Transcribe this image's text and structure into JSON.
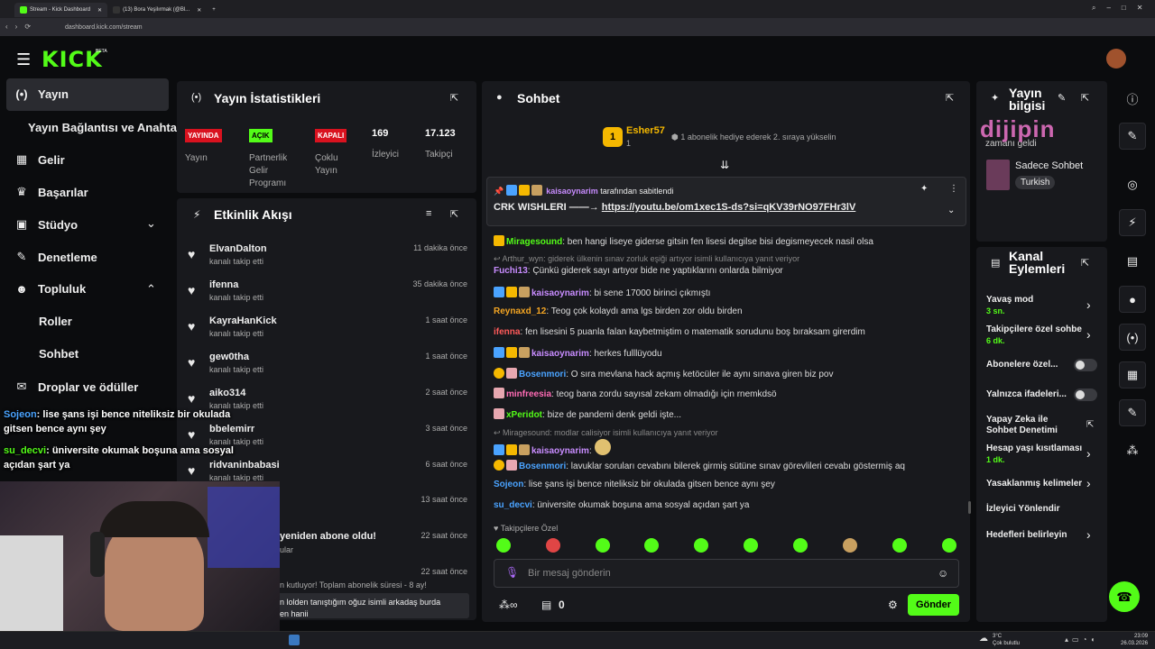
{
  "browser": {
    "tabs": [
      {
        "label": "Stream - Kick Dashboard",
        "active": true
      },
      {
        "label": "(13) Bora Yeşilırmak (@Bl...",
        "active": false
      }
    ],
    "url": "dashboard.kick.com/stream"
  },
  "brand": {
    "logo": "KICK",
    "beta": "BETA",
    "accent": "#53fc18"
  },
  "sidebar": {
    "items": [
      {
        "label": "Yayın",
        "icon": "broadcast-icon",
        "active": true
      },
      {
        "label": "Yayın Bağlantısı ve Anahtarı",
        "icon": ""
      },
      {
        "label": "Gelir",
        "icon": "chart-icon"
      },
      {
        "label": "Başarılar",
        "icon": "trophy-icon"
      },
      {
        "label": "Stüdyo",
        "icon": "studio-icon"
      },
      {
        "label": "Denetleme",
        "icon": "wrench-icon"
      },
      {
        "label": "Topluluk",
        "icon": "community-icon"
      },
      {
        "label": "Roller",
        "icon": ""
      },
      {
        "label": "Sohbet",
        "icon": ""
      },
      {
        "label": "Droplar ve ödüller",
        "icon": "gift-icon"
      }
    ]
  },
  "stats": {
    "title": "Yayın İstatistikleri",
    "badges": [
      "YAYINDA",
      "AÇIK",
      "KAPALI"
    ],
    "labels": [
      "Yayın",
      "Partnerlik Gelir Programı",
      "Çoklu Yayın"
    ],
    "viewers": "169",
    "viewers_label": "İzleyici",
    "followers": "17.123",
    "followers_label": "Takipçi"
  },
  "activity": {
    "title": "Etkinlik Akışı",
    "items": [
      {
        "name": "ElvanDalton",
        "action": "kanalı takip etti",
        "time": "11 dakika önce"
      },
      {
        "name": "ifenna",
        "action": "kanalı takip etti",
        "time": "35 dakika önce"
      },
      {
        "name": "KayraHanKick",
        "action": "kanalı takip etti",
        "time": "1 saat önce"
      },
      {
        "name": "gew0tha",
        "action": "kanalı takip etti",
        "time": "1 saat önce"
      },
      {
        "name": "aiko314",
        "action": "kanalı takip etti",
        "time": "2 saat önce"
      },
      {
        "name": "bbelemirr",
        "action": "kanalı takip etti",
        "time": "3 saat önce"
      },
      {
        "name": "ridvaninbabasi",
        "action": "kanalı takip etti",
        "time": "6 saat önce"
      }
    ],
    "extra": [
      {
        "text": "",
        "time": "13 saat önce"
      },
      {
        "text": "yeniden abone oldu!",
        "sub": "ular",
        "time": "22 saat önce"
      },
      {
        "text": "",
        "time": "22 saat önce"
      }
    ],
    "sub_line": "n kutluyor! Toplam abonelik süresi - 8 ay!",
    "sub_msg": "n lolden tanıştığım oğuz isimli arkadaş burda",
    "sub_msg2": "en hanii"
  },
  "chat": {
    "title": "Sohbet",
    "gifter": {
      "rank": "1",
      "name": "Esher57",
      "count": "1",
      "note": "1 abonelik hediye ederek 2. sıraya yükselin"
    },
    "pinned": {
      "user": "kaisaoynarim",
      "by": "tarafından sabitlendi",
      "text": "CRK WISHLERI ——→",
      "link": "https://youtu.be/om1xec1S-ds?si=qKV39rNO97FHr3lV"
    },
    "messages": [
      {
        "type": "msg",
        "user": "Miragesound",
        "color": "#53fc18",
        "text": "ben hangi liseye giderse gitsin fen lisesi degilse bisi degismeyecek nasil olsa"
      },
      {
        "type": "reply",
        "text": "Arthur_wyn: giderek ülkenin sınav zorluk eşiği artıyor isimli kullanıcıya yanıt veriyor"
      },
      {
        "type": "msg",
        "user": "Fuchi13",
        "color": "#c88cff",
        "text": "Çünkü giderek sayı artıyor bide ne yaptıklarını onlarda bilmiyor"
      },
      {
        "type": "msg",
        "user": "kaisaoynarim",
        "color": "#c88cff",
        "text": "bi sene 17000 birinci çıkmıştı"
      },
      {
        "type": "msg",
        "user": "Reynaxd_12",
        "color": "#f5a623",
        "text": "Teog çok kolaydı ama lgs birden zor oldu birden"
      },
      {
        "type": "msg",
        "user": "ifenna",
        "color": "#ff5a5a",
        "text": "fen lisesini 5 puanla falan kaybetmiştim o matematik sorudunu boş bıraksam girerdim"
      },
      {
        "type": "msg",
        "user": "kaisaoynarim",
        "color": "#c88cff",
        "text": "herkes fulllüyodu"
      },
      {
        "type": "msg",
        "user": "Bosenmori",
        "color": "#4aa3ff",
        "text": "O sıra mevlana hack açmış ketöcüler ile aynı sınava giren biz pov"
      },
      {
        "type": "msg",
        "user": "minfreesia",
        "color": "#ff6bb5",
        "text": "teog bana zordu sayısal zekam olmadığı için rnemkdsö"
      },
      {
        "type": "msg",
        "user": "xPeridot",
        "color": "#53fc18",
        "text": "bize de pandemi denk geldi işte..."
      },
      {
        "type": "reply",
        "text": "Miragesound: modlar calisiyor isimli kullanıcıya yanıt veriyor"
      },
      {
        "type": "msg",
        "user": "kaisaoynarim",
        "color": "#c88cff",
        "text": ""
      },
      {
        "type": "msg",
        "user": "Bosenmori",
        "color": "#4aa3ff",
        "text": "lavuklar soruları cevabını bilerek girmiş sütüne sınav görevlileri cevabı göstermiş aq"
      },
      {
        "type": "msg",
        "user": "Sojeon",
        "color": "#4aa3ff",
        "text": "lise şans işi bence niteliksiz bir okulada gitsen bence aynı şey"
      },
      {
        "type": "msg",
        "user": "su_decvi",
        "color": "#4aa3ff",
        "text": "üniversite okumak boşuna ama sosyal açıdan şart ya"
      }
    ],
    "followers_only": "Takipçilere Özel",
    "input_placeholder": "Bir mesaj gönderin",
    "points": "0",
    "send_label": "Gönder"
  },
  "stream_info": {
    "title": "Yayın bilgisi",
    "category": "Sadece Sohbet",
    "language": "Turkish",
    "subtitle_partial": "zamanı geldi"
  },
  "channel_actions": {
    "title": "Kanal Eylemleri",
    "items": [
      {
        "label": "Yavaş mod",
        "sub": "3 sn.",
        "control": "chevron"
      },
      {
        "label": "Takipçilere özel sohbet",
        "sub": "6 dk.",
        "control": "chevron"
      },
      {
        "label": "Abonelere özel...",
        "sub": "",
        "control": "toggle"
      },
      {
        "label": "Yalnızca ifadeleri...",
        "sub": "",
        "control": "toggle"
      },
      {
        "label": "Yapay Zeka ile Sohbet Denetimi",
        "sub": "",
        "control": "external"
      },
      {
        "label": "Hesap yaşı kısıtlaması",
        "sub": "1 dk.",
        "control": "chevron"
      },
      {
        "label": "Yasaklanmış kelimeler",
        "sub": "",
        "control": "chevron"
      },
      {
        "label": "İzleyici Yönlendir",
        "sub": "",
        "control": "none"
      },
      {
        "label": "Hedefleri belirleyin",
        "sub": "",
        "control": "chevron"
      }
    ]
  },
  "overlay": {
    "watermark": "dijipin",
    "lines": [
      {
        "user": "Sojeon",
        "text": ": lise şans işi bence niteliksiz bir okulada gitsen bence aynı şey"
      },
      {
        "user": "su_decvi",
        "text": ": üniversite okumak boşuna ama sosyal açıdan şart ya"
      }
    ]
  },
  "taskbar": {
    "weather": "3°C",
    "weather_desc": "Çok bulutlu",
    "time": "23:09",
    "date": "26.03.2026"
  }
}
